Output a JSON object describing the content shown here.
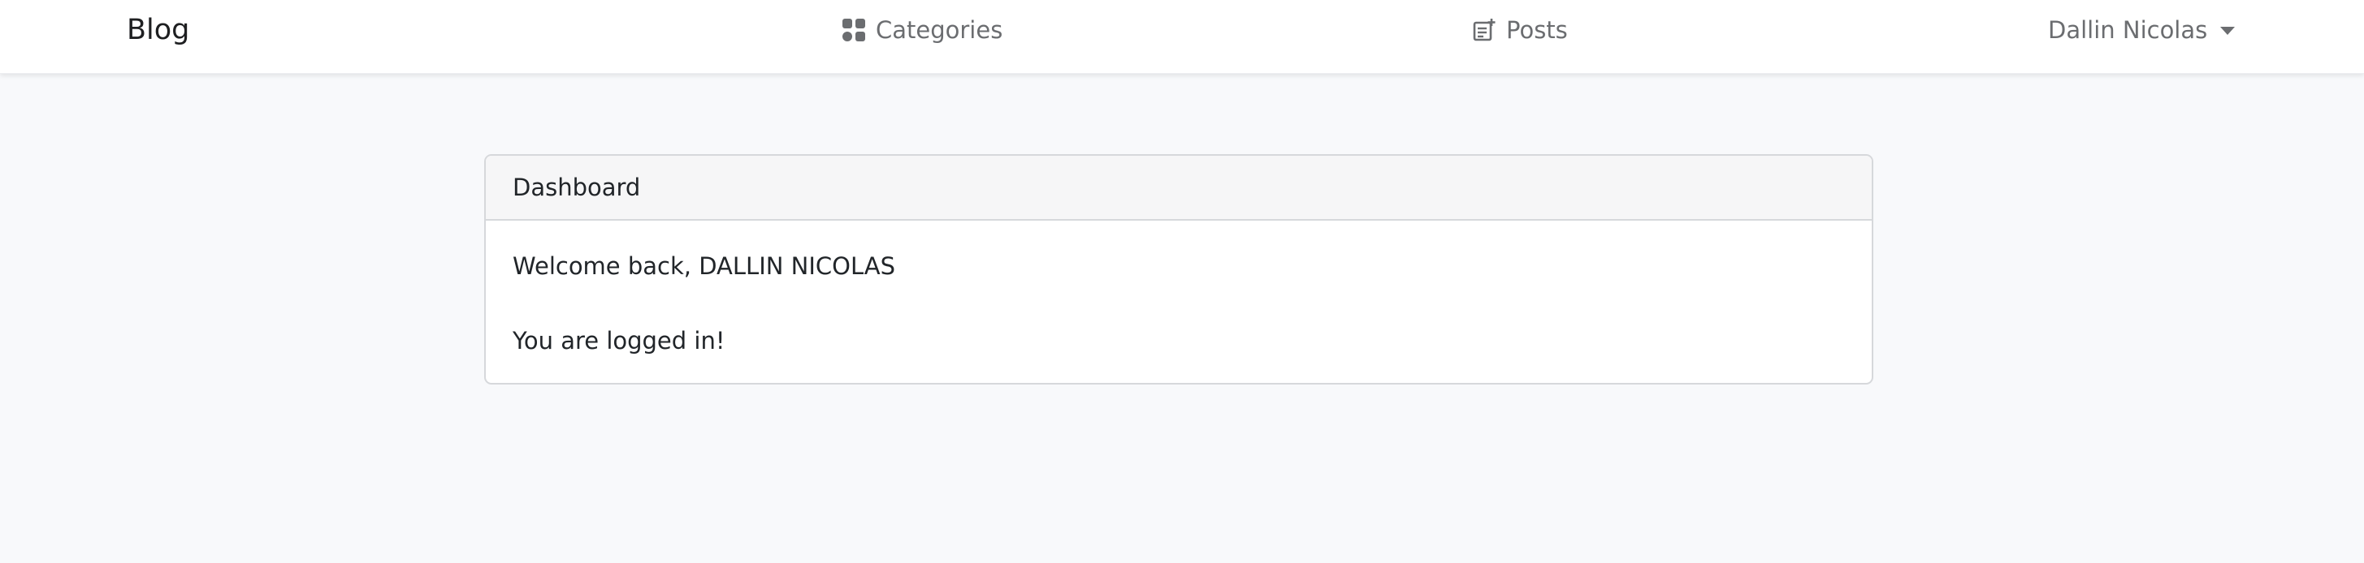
{
  "navbar": {
    "brand": "Blog",
    "categories_label": "Categories",
    "categories_icon": "categories-grid-icon",
    "posts_label": "Posts",
    "posts_icon": "post-add-icon",
    "user_name": "Dallin Nicolas",
    "user_icon": "caret-down-icon"
  },
  "card": {
    "header": "Dashboard",
    "welcome_text": "Welcome back, DALLIN NICOLAS",
    "status_text": "You are logged in!"
  },
  "colors": {
    "page_background": "#f8f9fb",
    "navbar_background": "#ffffff",
    "nav_link": "#6b6d70",
    "card_header_background": "#f6f6f7",
    "card_border": "#d6d8db"
  }
}
